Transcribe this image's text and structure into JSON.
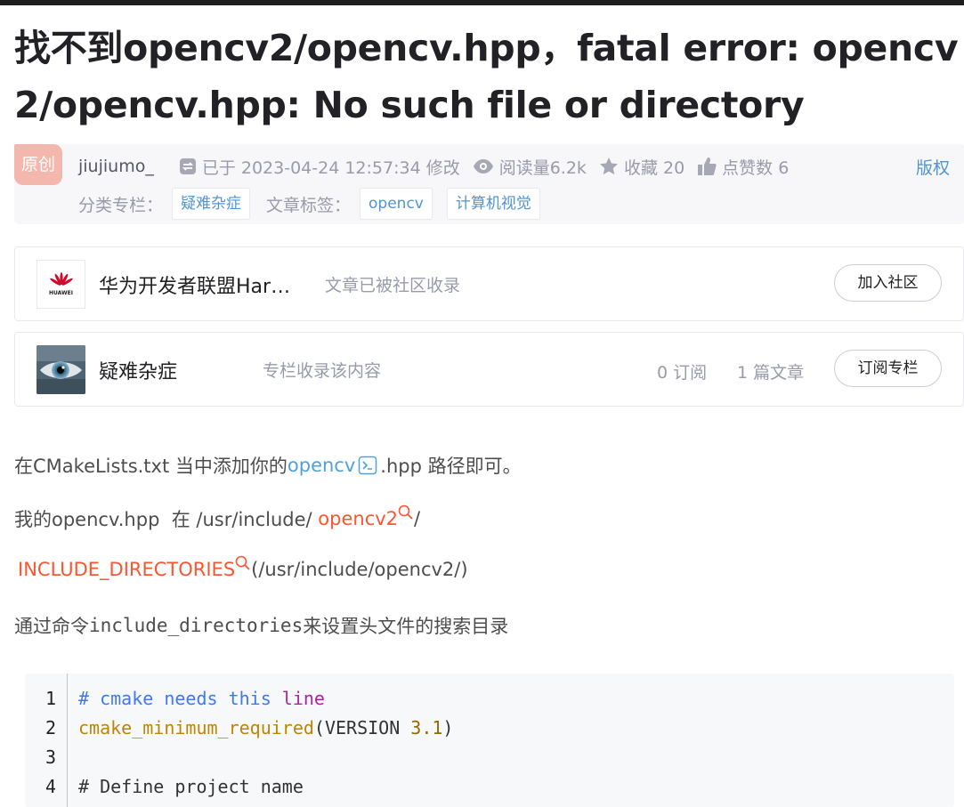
{
  "title": "找不到opencv2/opencv.hpp，fatal error: opencv2/opencv.hpp: No such file or directory",
  "meta": {
    "badge": "原创",
    "author": "jiujiumo_",
    "edited": "已于 2023-04-24 12:57:34 修改",
    "reads": "阅读量6.2k",
    "favorites": "收藏 20",
    "likes": "点赞数 6",
    "copyright": "版权",
    "category_label": "分类专栏：",
    "category": "疑难杂症",
    "tags_label": "文章标签：",
    "tags": [
      "opencv",
      "计算机视觉"
    ]
  },
  "community_card": {
    "logo_text": "HUAWEI",
    "name": "华为开发者联盟Har…",
    "desc": "文章已被社区收录",
    "button": "加入社区"
  },
  "column_card": {
    "name": "疑难杂症",
    "desc": "专栏收录该内容",
    "subscribers": "0 订阅",
    "articles": "1 篇文章",
    "button": "订阅专栏"
  },
  "content": {
    "p1_before": "在CMakeLists.txt  当中添加你的",
    "p1_link": "opencv",
    "p1_after": ".hpp 路径即可。",
    "p2_before": "我的opencv.hpp  在 /usr/include/ ",
    "p2_link": "opencv2",
    "p2_after": "/",
    "p3_link": "INCLUDE_DIRECTORIES",
    "p3_after": "(/usr/include/opencv2/)",
    "p4_before": "通过命令",
    "p4_code": "include_directories",
    "p4_after": "来设置头文件的搜索目录"
  },
  "code": {
    "line_numbers": [
      "1",
      "2",
      "3",
      "4"
    ],
    "l1_hash": "# ",
    "l1_a": "cmake needs this ",
    "l1_b": "line",
    "l2_fn": "cmake_minimum_required",
    "l2_mid": "(VERSION ",
    "l2_num": "3.1",
    "l2_end": ")",
    "l4": "# Define project name"
  },
  "colors": {
    "link_blue": "#4ea1db",
    "link_red": "#fc5531",
    "badge_bg": "#f4b7ad",
    "copyright_blue": "#5094d5"
  }
}
